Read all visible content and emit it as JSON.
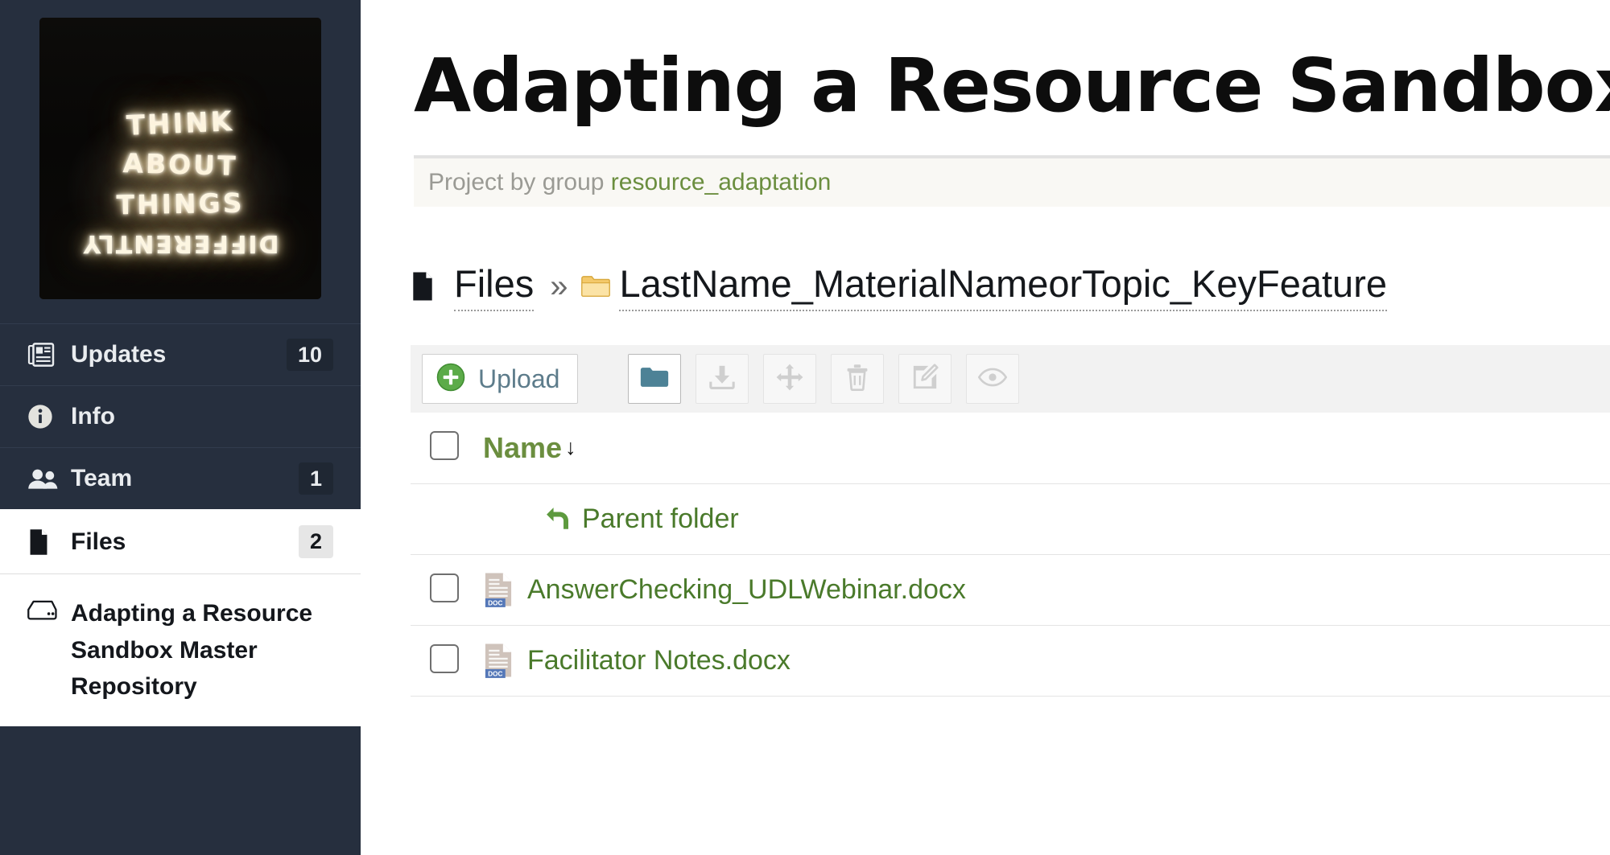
{
  "sidebar": {
    "photo": {
      "name": "project-cover-photo",
      "alt": "Neon sign photo",
      "lines": [
        "THINK",
        "ABOUT",
        "THINGS",
        "DIFFERENTLY"
      ]
    },
    "items": [
      {
        "label": "Updates",
        "badge": "10",
        "icon": "newspaper-icon",
        "active": false
      },
      {
        "label": "Info",
        "badge": "",
        "icon": "info-circle-icon",
        "active": false
      },
      {
        "label": "Team",
        "badge": "1",
        "icon": "users-icon",
        "active": false
      },
      {
        "label": "Files",
        "badge": "2",
        "icon": "file-icon",
        "active": true
      },
      {
        "label": "Adapting a Resource Sandbox Master Repository",
        "badge": "",
        "icon": "storage-drive-icon",
        "active": false
      }
    ]
  },
  "header": {
    "title": "Adapting a Resource Sandbox",
    "subtitle_prefix": "Project by group",
    "group_name": "resource_adaptation"
  },
  "breadcrumb": {
    "root_label": "Files",
    "separator": "»",
    "current_label": "LastName_MaterialNameorTopic_KeyFeature"
  },
  "toolbar": {
    "upload_label": "Upload",
    "buttons": [
      {
        "name": "new-folder-button",
        "icon": "folder-icon",
        "state": "active"
      },
      {
        "name": "download-button",
        "icon": "download-icon",
        "state": "disabled"
      },
      {
        "name": "move-button",
        "icon": "move-arrows-icon",
        "state": "disabled"
      },
      {
        "name": "delete-button",
        "icon": "trash-icon",
        "state": "disabled"
      },
      {
        "name": "rename-button",
        "icon": "edit-pencil-icon",
        "state": "disabled"
      },
      {
        "name": "view-button",
        "icon": "eye-icon",
        "state": "disabled"
      }
    ]
  },
  "file_table": {
    "columns": [
      "",
      "Name"
    ],
    "sort_column": "Name",
    "sort_direction": "↓",
    "parent_row_label": "Parent folder",
    "rows": [
      {
        "name": "AnswerChecking_UDLWebinar.docx",
        "icon": "doc-file-icon",
        "badge": "DOC"
      },
      {
        "name": "Facilitator Notes.docx",
        "icon": "doc-file-icon",
        "badge": "DOC"
      }
    ]
  },
  "colors": {
    "sidebar_bg": "#262f3e",
    "accent_green": "#6b8e3f",
    "link_green": "#4a7a2b",
    "toolbar_bg": "#f2f2f2",
    "folder_teal": "#4d8296",
    "upload_blue": "#5d7c8b"
  }
}
